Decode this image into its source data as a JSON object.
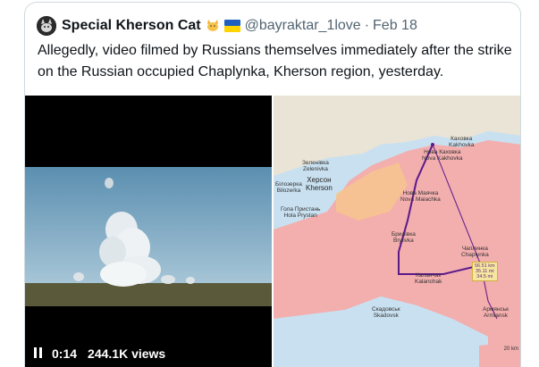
{
  "tweet": {
    "display_name": "Special Kherson Cat",
    "handle": "@bayraktar_1love",
    "separator": "·",
    "date": "Feb 18",
    "text": "Allegedly, video filmed by Russians themselves immediately after the strike on the Russian occupied Chaplynka, Kherson region, yesterday."
  },
  "video": {
    "time": "0:14",
    "views": "244.1K views",
    "pause_icon": "pause-icon"
  },
  "map": {
    "labels": {
      "kakhovka": "Каховка\nKakhovka",
      "nova_kakhovka": "Нова Каховка\nNova Kakhovka",
      "zelenivka": "Зеленівка\nZelenivka",
      "bilozerka": "Білозерка\nBilozerka",
      "kherson": "Херсон\nKherson",
      "nova_maiachka": "Нова Маячка\nNova Maiachka",
      "hola_prystan": "Гола Пристань\nHola Prystan",
      "brylivka": "Брилівка\nBrylivka",
      "chaplynka": "Чаплинка\nChaplynka",
      "kalanchak": "Каланчак\nKalanchak",
      "skadovsk": "Скадовськ\nSkadovsk",
      "armiansk": "Армянськ\nArmiansk"
    },
    "distance": "56.51 km\n35.11 mi\n34.5 mi",
    "scale": "20 km"
  },
  "colors": {
    "occupied": "#f3aeae",
    "controlled": "#e9e4d6",
    "water": "#c9e0f0",
    "route": "#5a1a8a",
    "handle_gray": "#536471"
  }
}
